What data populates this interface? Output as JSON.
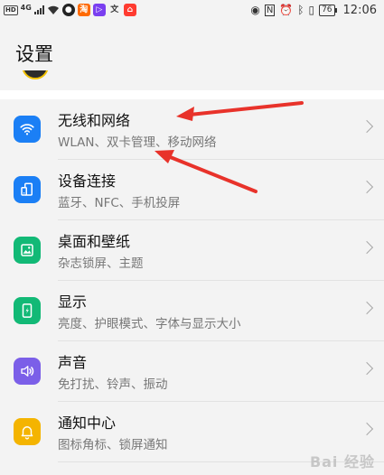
{
  "status_bar": {
    "left_hd": "HD",
    "left_network": "4G",
    "battery": "76",
    "time": "12:06",
    "icons_left": [
      "signal-icon",
      "wifi-icon",
      "qq-icon",
      "taobao-icon",
      "app-icon",
      "app-icon",
      "app-icon"
    ],
    "icons_right": [
      "eye-icon",
      "nfc-icon",
      "alarm-icon",
      "bluetooth-icon",
      "vibrate-icon"
    ]
  },
  "header": {
    "title": "设置"
  },
  "items": [
    {
      "title": "无线和网络",
      "subtitle": "WLAN、双卡管理、移动网络",
      "icon": "wifi-icon",
      "color": "#1b7ff5"
    },
    {
      "title": "设备连接",
      "subtitle": "蓝牙、NFC、手机投屏",
      "icon": "device-connection-icon",
      "color": "#1b7ff5"
    },
    {
      "title": "桌面和壁纸",
      "subtitle": "杂志锁屏、主题",
      "icon": "wallpaper-icon",
      "color": "#12b976"
    },
    {
      "title": "显示",
      "subtitle": "亮度、护眼模式、字体与显示大小",
      "icon": "display-icon",
      "color": "#12b976"
    },
    {
      "title": "声音",
      "subtitle": "免打扰、铃声、振动",
      "icon": "sound-icon",
      "color": "#7b5fe8"
    },
    {
      "title": "通知中心",
      "subtitle": "图标角标、锁屏通知",
      "icon": "bell-icon",
      "color": "#f4b400"
    }
  ],
  "annotation": {
    "arrow_color": "#e8322a"
  },
  "watermark": {
    "text": "Bai 经验"
  }
}
